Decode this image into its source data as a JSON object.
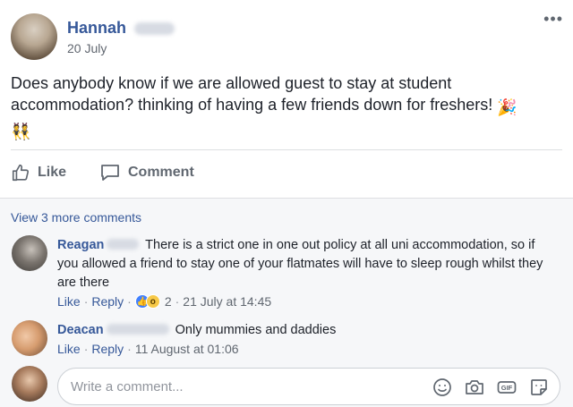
{
  "post": {
    "author": "Hannah",
    "date": "20 July",
    "menu_glyph": "•••",
    "text": "Does anybody know if we are allowed guest to stay at student accommodation? thinking of having a few friends down for freshers!",
    "emoji_party": "🎉",
    "emoji_people": "👯",
    "actions": {
      "like_label": "Like",
      "comment_label": "Comment"
    }
  },
  "comments": {
    "view_more": "View 3 more comments",
    "items": [
      {
        "name": "Reagan",
        "text": "There is a strict one in one out policy at all uni accommodation, so if you allowed a friend to stay one of your flatmates will have to sleep rough whilst they are there",
        "like_label": "Like",
        "reply_label": "Reply",
        "reaction_count": "2",
        "timestamp": "21 July at 14:45"
      },
      {
        "name": "Deacan",
        "text": "Only mummies and daddies",
        "like_label": "Like",
        "reply_label": "Reply",
        "timestamp": "11 August at 01:06"
      }
    ]
  },
  "composer": {
    "placeholder": "Write a comment..."
  },
  "colors": {
    "link": "#365899",
    "meta": "#606770",
    "comments_bg": "#f6f7f9",
    "like_reaction": "#4080ff",
    "wow_reaction": "#f7c948"
  },
  "icons": [
    "more-icon",
    "like-thumb-icon",
    "comment-bubble-icon",
    "like-reaction-icon",
    "wow-reaction-icon",
    "emoji-icon",
    "camera-icon",
    "gif-icon",
    "sticker-icon"
  ]
}
